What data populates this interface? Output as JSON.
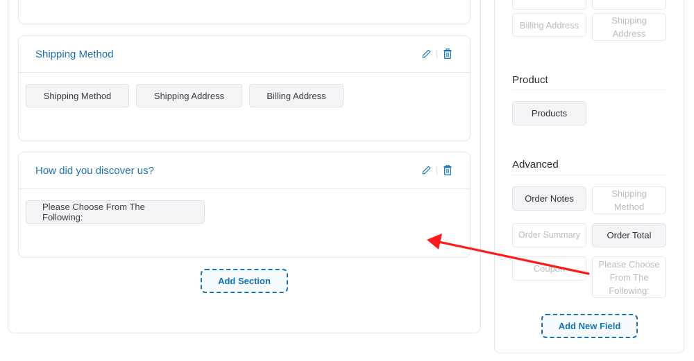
{
  "builder": {
    "sections": [
      {
        "title": "Shipping Method",
        "fields": [
          "Shipping Method",
          "Shipping Address",
          "Billing Address"
        ]
      },
      {
        "title": "How did you discover us?",
        "fields": [
          "Please Choose From The Following:"
        ]
      }
    ],
    "add_section_label": "Add Section",
    "icons": {
      "edit": "pencil-icon",
      "delete": "trash-icon"
    }
  },
  "sidebar": {
    "top_fields": [
      {
        "label": "Billing Address",
        "state": "disabled"
      },
      {
        "label": "Shipping Address",
        "state": "disabled"
      }
    ],
    "groups": [
      {
        "title": "Product",
        "fields": [
          {
            "label": "Products",
            "state": "active"
          }
        ]
      },
      {
        "title": "Advanced",
        "fields": [
          {
            "label": "Order Notes",
            "state": "active"
          },
          {
            "label": "Shipping Method",
            "state": "disabled"
          },
          {
            "label": "Order Summary",
            "state": "disabled"
          },
          {
            "label": "Order Total",
            "state": "active"
          },
          {
            "label": "Coupon",
            "state": "disabled"
          },
          {
            "label": "Please Choose From The Following:",
            "state": "disabled"
          }
        ]
      }
    ],
    "add_field_label": "Add New Field"
  },
  "annotation": {
    "type": "arrow",
    "color": "#ff0000"
  },
  "colors": {
    "accent": "#1773b1",
    "chip_bg": "#f4f4f6",
    "border": "#e4e6ee"
  }
}
